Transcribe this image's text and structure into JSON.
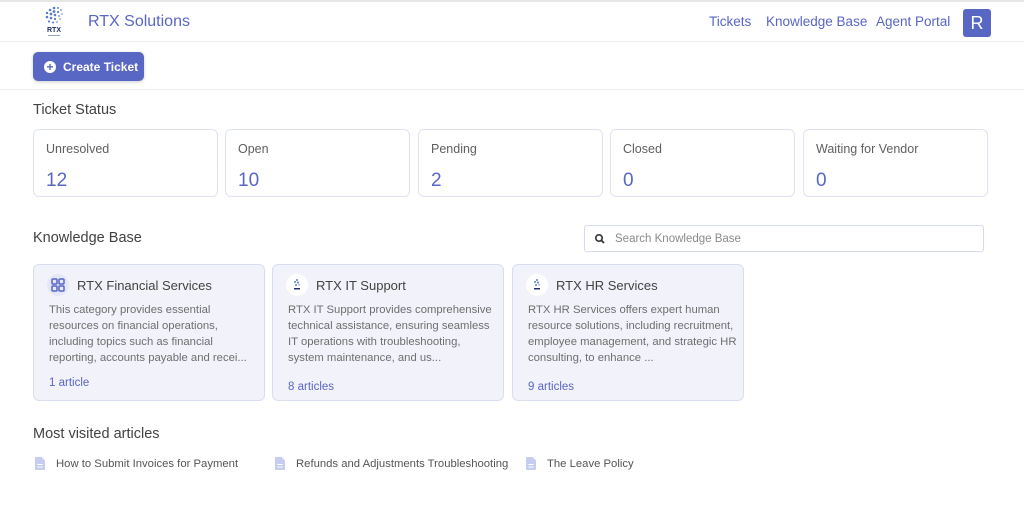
{
  "header": {
    "logo_text": "RTX",
    "brand": "RTX Solutions",
    "nav": [
      "Tickets",
      "Knowledge Base",
      "Agent Portal"
    ],
    "avatar_initial": "R"
  },
  "toolbar": {
    "create_ticket_label": "Create Ticket"
  },
  "ticket_status": {
    "title": "Ticket Status",
    "cards": [
      {
        "label": "Unresolved",
        "value": "12"
      },
      {
        "label": "Open",
        "value": "10"
      },
      {
        "label": "Pending",
        "value": "2"
      },
      {
        "label": "Closed",
        "value": "0"
      },
      {
        "label": "Waiting for Vendor",
        "value": "0"
      }
    ]
  },
  "knowledge_base": {
    "title": "Knowledge Base",
    "search_placeholder": "Search Knowledge Base",
    "categories": [
      {
        "title": "RTX Financial Services",
        "icon": "grid-icon",
        "description": "This category provides essential resources on financial operations, including topics such as financial reporting, accounts payable and recei...",
        "count": "1 article"
      },
      {
        "title": "RTX IT Support",
        "icon": "rtx-logo-icon",
        "description": "RTX IT Support provides comprehensive technical assistance, ensuring seamless IT operations with troubleshooting, system maintenance, and us...",
        "count": "8 articles"
      },
      {
        "title": "RTX HR Services",
        "icon": "rtx-logo-icon",
        "description": "RTX HR Services offers expert human resource solutions, including recruitment, employee management, and strategic HR consulting, to enhance ...",
        "count": "9 articles"
      }
    ]
  },
  "most_visited": {
    "title": "Most visited articles",
    "articles": [
      "How to Submit Invoices for Payment",
      "Refunds and Adjustments Troubleshooting",
      "The Leave Policy"
    ]
  },
  "colors": {
    "accent": "#5866c4",
    "card_bg": "#f2f3fa",
    "card_border": "#d9ddf2"
  }
}
